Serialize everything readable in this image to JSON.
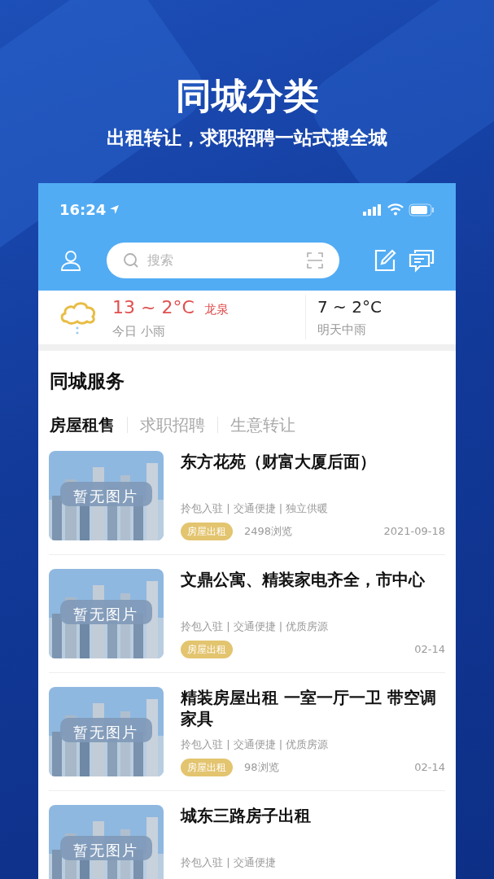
{
  "headline": "同城分类",
  "subheadline": "出租转让，求职招聘一站式搜全城",
  "status_bar": {
    "time": "16:24"
  },
  "search": {
    "placeholder": "搜索"
  },
  "weather": {
    "today_range": "13 ~ 2°C",
    "city": "龙泉",
    "today_desc": "今日 小雨",
    "tomorrow_range": "7 ~ 2°C",
    "tomorrow_desc": "明天中雨"
  },
  "section_title": "同城服务",
  "tabs": [
    {
      "label": "房屋租售",
      "selected": true
    },
    {
      "label": "求职招聘",
      "selected": false
    },
    {
      "label": "生意转让",
      "selected": false
    }
  ],
  "listings": [
    {
      "image_label": "暂无图片",
      "title": "东方花苑（财富大厦后面）",
      "features": "拎包入驻 | 交通便捷 | 独立供暖",
      "category": "房屋出租",
      "views": "2498浏览",
      "date": "2021-09-18"
    },
    {
      "image_label": "暂无图片",
      "title": "文鼎公寓、精装家电齐全，市中心",
      "features": "拎包入驻 | 交通便捷 | 优质房源",
      "category": "房屋出租",
      "date": "02-14"
    },
    {
      "image_label": "暂无图片",
      "title": "精装房屋出租 一室一厅一卫 带空调家具",
      "features": "拎包入驻 | 交通便捷 | 优质房源",
      "category": "房屋出租",
      "views": "98浏览",
      "date": "02-14"
    },
    {
      "image_label": "暂无图片",
      "title": "城东三路房子出租",
      "features": "拎包入驻 | 交通便捷"
    }
  ]
}
